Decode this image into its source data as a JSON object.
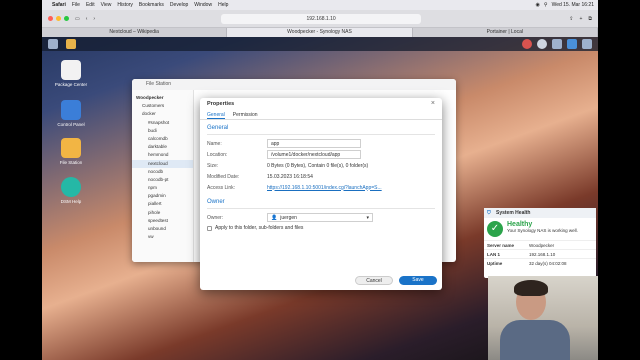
{
  "menubar": {
    "app": "Safari",
    "items": [
      "File",
      "Edit",
      "View",
      "History",
      "Bookmarks",
      "Develop",
      "Window",
      "Help"
    ],
    "clock": "Wed 15. Mar 16:21"
  },
  "browser": {
    "url": "192.168.1.10",
    "tabs": [
      "Nextcloud – Wikipedia",
      "Woodpecker - Synology NAS",
      "Portainer | Local"
    ]
  },
  "desktop_icons": [
    {
      "label": "Package Center"
    },
    {
      "label": "Control Panel"
    },
    {
      "label": "File Station"
    },
    {
      "label": "DSM Help"
    }
  ],
  "file_station": {
    "title": "File Station",
    "root": "Woodpecker",
    "tree": [
      "Customers",
      "docker",
      "#snapshot",
      "budi",
      "calcomdb",
      "darktable",
      "hemmond",
      "nextcloud",
      "nocodb",
      "nocodb-pt",
      "npm",
      "pgadmin",
      "piallert",
      "pihole",
      "speedtest",
      "unbound",
      "vw"
    ]
  },
  "dialog": {
    "title": "Properties",
    "tabs": [
      "General",
      "Permission"
    ],
    "general_section": "General",
    "name_label": "Name:",
    "name_value": "app",
    "location_label": "Location:",
    "location_value": "/volume1/docker/nextcloud/app",
    "size_label": "Size:",
    "size_value": "0 Bytes (0 Bytes), Contain 0 file(s), 0 folder(s)",
    "modified_label": "Modified Date:",
    "modified_value": "15.03.2023 16:18:54",
    "access_label": "Access Link:",
    "access_value": "https://192.168.1.10:5001/index.cgi?launchApp=S...",
    "owner_section": "Owner",
    "owner_label": "Owner:",
    "owner_value": "juergen",
    "apply_label": "Apply to this folder, sub-folders and files",
    "cancel": "Cancel",
    "save": "Save"
  },
  "health": {
    "title": "System Health",
    "status": "Healthy",
    "message": "Your Synology NAS is working well.",
    "rows": [
      {
        "k": "Server name",
        "v": "Woodpecker"
      },
      {
        "k": "LAN 1",
        "v": "192.168.1.10"
      },
      {
        "k": "Uptime",
        "v": "32 day(s) 04:02:08"
      }
    ]
  }
}
